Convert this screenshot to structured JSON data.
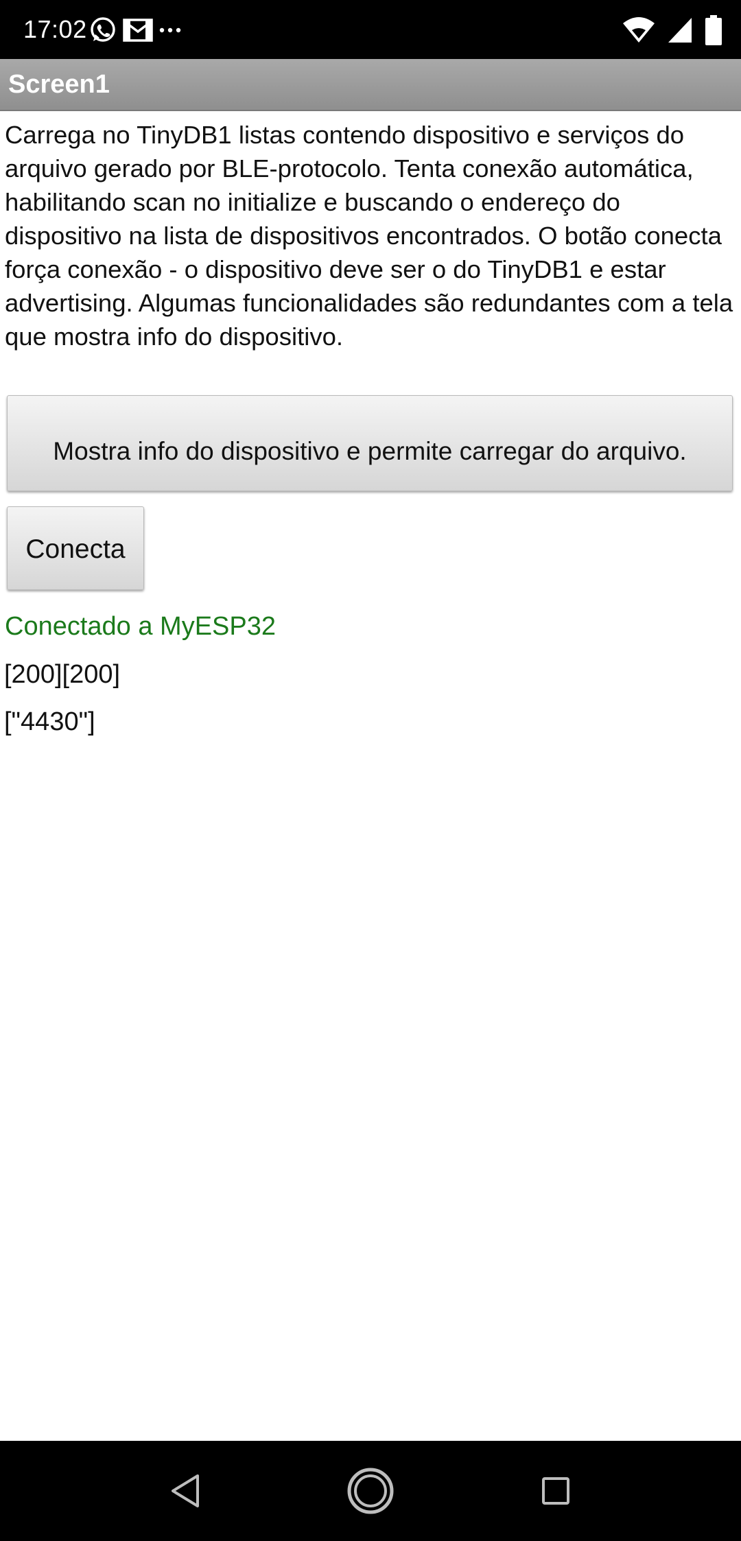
{
  "status_bar": {
    "time": "17:02",
    "notification_icons": [
      "whatsapp-icon",
      "gmail-icon",
      "more-dots-icon"
    ],
    "system_icons": [
      "wifi-icon",
      "signal-icon",
      "battery-icon"
    ]
  },
  "title_bar": {
    "title": "Screen1"
  },
  "main": {
    "description": "Carrega no TinyDB1 listas contendo dispositivo e serviços do arquivo gerado por BLE-protocolo. Tenta conexão automática, habilitando scan no initialize e buscando o endereço do dispositivo na lista de dispositivos encontrados. O botão conecta força conexão - o dispositivo deve ser o do TinyDB1 e estar advertising. Algumas funcionalidades são redundantes com a tela que mostra info do dispositivo.",
    "info_button_label": "Mostra info do dispositivo e permite carregar do arquivo.",
    "connect_button_label": "Conecta",
    "connection_status": "Conectado a MyESP32",
    "line_one": "[200][200]",
    "line_two": "[\"4430\"]"
  },
  "nav_bar": {
    "icons": [
      "back-icon",
      "home-icon",
      "recents-icon"
    ]
  },
  "colors": {
    "status_green": "#1b7a1b",
    "title_bar_gray": "#9c9c9c",
    "system_bar_black": "#000000"
  }
}
